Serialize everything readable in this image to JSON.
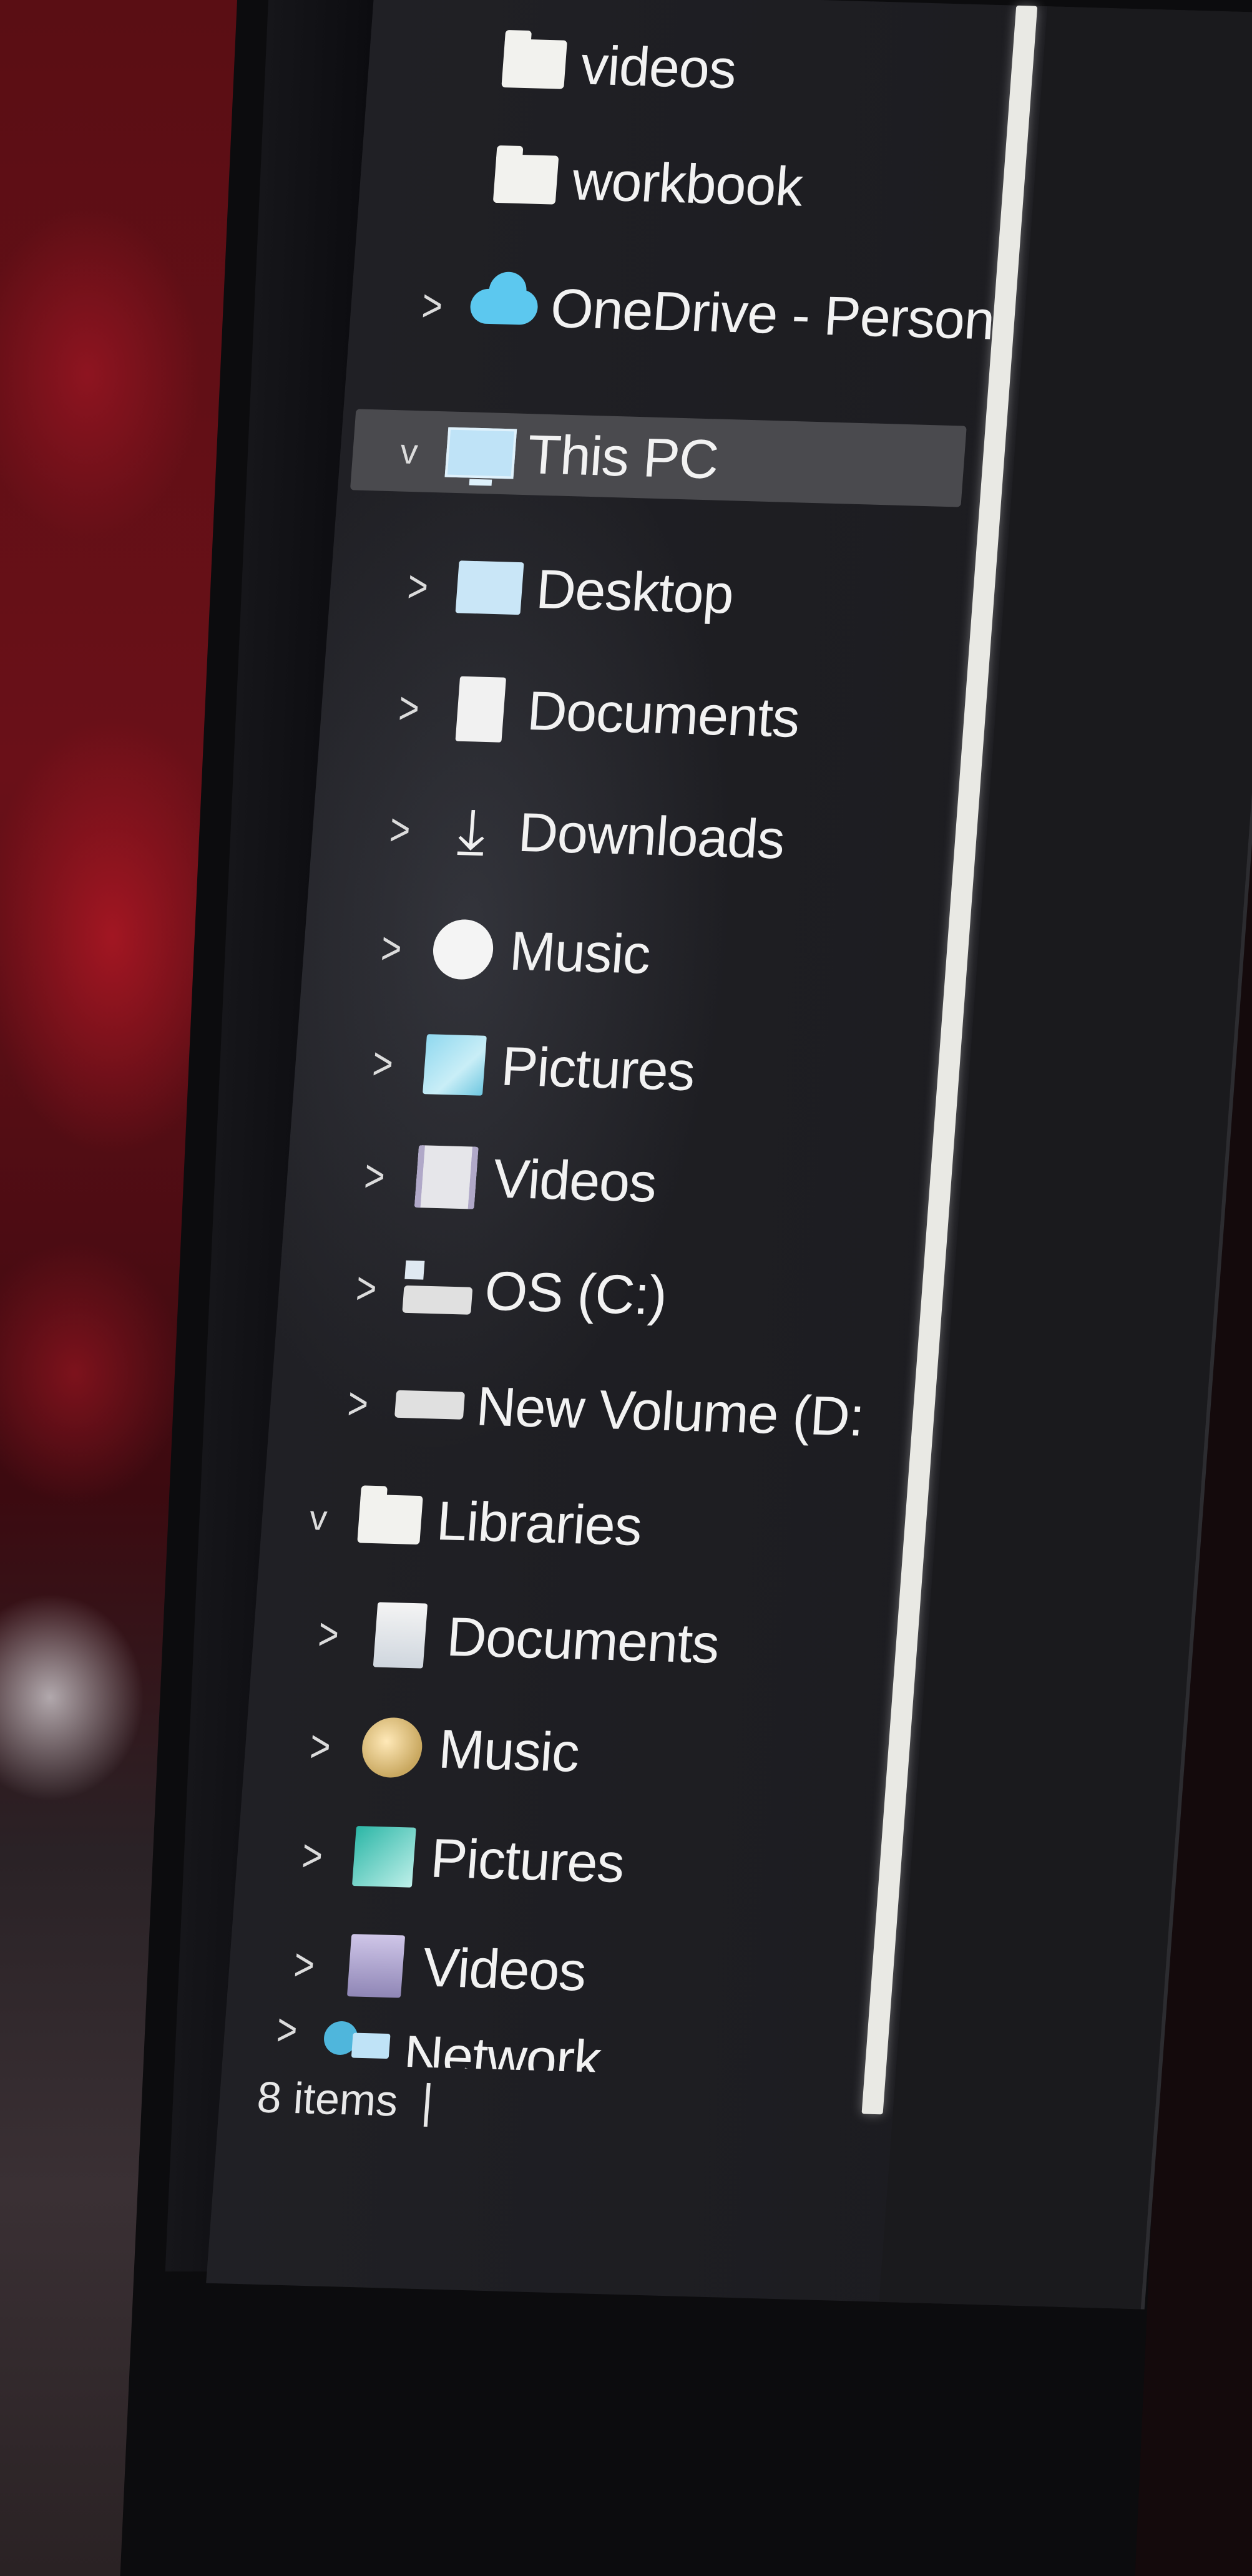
{
  "nav": {
    "items": [
      {
        "id": "videos-folder",
        "label": "videos",
        "icon": "folder-icon",
        "chevron": "",
        "selected": false
      },
      {
        "id": "workbook-folder",
        "label": "workbook",
        "icon": "folder-icon",
        "chevron": "",
        "selected": false
      },
      {
        "id": "onedrive",
        "label": "OneDrive - Person",
        "icon": "cloud-icon",
        "chevron": ">",
        "selected": false
      },
      {
        "id": "this-pc",
        "label": "This PC",
        "icon": "monitor-icon",
        "chevron": "v",
        "selected": true
      },
      {
        "id": "desktop",
        "label": "Desktop",
        "icon": "desktop-icon",
        "chevron": ">",
        "selected": false
      },
      {
        "id": "documents",
        "label": "Documents",
        "icon": "document-icon",
        "chevron": ">",
        "selected": false
      },
      {
        "id": "downloads",
        "label": "Downloads",
        "icon": "download-arrow-icon",
        "chevron": ">",
        "selected": false
      },
      {
        "id": "music",
        "label": "Music",
        "icon": "music-icon",
        "chevron": ">",
        "selected": false
      },
      {
        "id": "pictures",
        "label": "Pictures",
        "icon": "pictures-icon",
        "chevron": ">",
        "selected": false
      },
      {
        "id": "videos",
        "label": "Videos",
        "icon": "video-icon",
        "chevron": ">",
        "selected": false
      },
      {
        "id": "os-drive",
        "label": "OS (C:)",
        "icon": "windows-drive-icon",
        "chevron": ">",
        "selected": false
      },
      {
        "id": "new-volume",
        "label": "New Volume (D:",
        "icon": "drive-icon",
        "chevron": ">",
        "selected": false
      },
      {
        "id": "libraries",
        "label": "Libraries",
        "icon": "folder-icon",
        "chevron": "v",
        "selected": false
      },
      {
        "id": "lib-documents",
        "label": "Documents",
        "icon": "library-document-icon",
        "chevron": ">",
        "selected": false
      },
      {
        "id": "lib-music",
        "label": "Music",
        "icon": "library-music-icon",
        "chevron": ">",
        "selected": false
      },
      {
        "id": "lib-pictures",
        "label": "Pictures",
        "icon": "library-pictures-icon",
        "chevron": ">",
        "selected": false
      },
      {
        "id": "lib-videos",
        "label": "Videos",
        "icon": "library-video-icon",
        "chevron": ">",
        "selected": false
      },
      {
        "id": "network",
        "label": "Network",
        "icon": "network-icon",
        "chevron": ">",
        "selected": false
      }
    ]
  },
  "status_bar": {
    "item_count": "8 items"
  },
  "colors": {
    "pane_background": "#1b1b1f",
    "selected_row": "#4a4a4e",
    "text": "#f2f2f2",
    "onedrive_cloud": "#5cc8ef"
  }
}
